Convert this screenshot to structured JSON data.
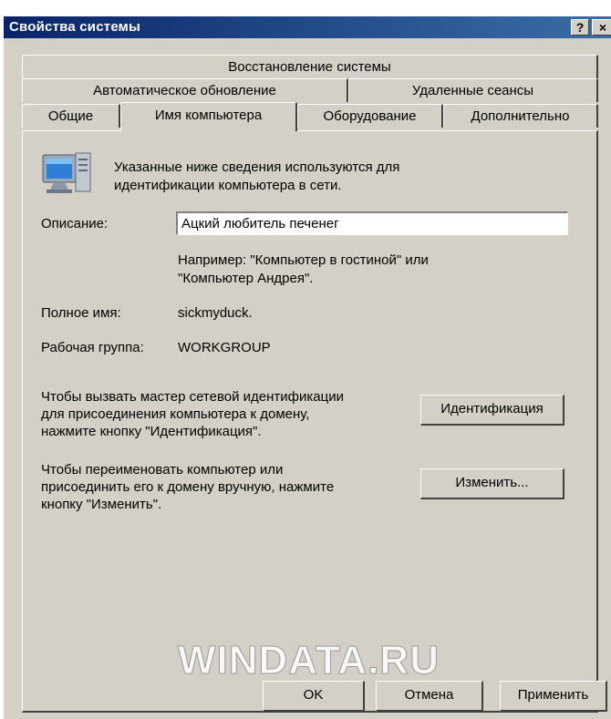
{
  "window": {
    "title": "Свойства системы",
    "help_glyph": "?",
    "close_glyph": "×"
  },
  "tabs": {
    "row1": [
      "Восстановление системы"
    ],
    "row2": [
      "Автоматическое обновление",
      "Удаленные сеансы"
    ],
    "row3": [
      "Общие",
      "Имя компьютера",
      "Оборудование",
      "Дополнительно"
    ],
    "active": "Имя компьютера"
  },
  "panel": {
    "intro_line1": "Указанные ниже сведения используются для",
    "intro_line2": "идентификации компьютера в сети.",
    "description_label": "Описание:",
    "description_value": "Ацкий любитель печенег",
    "example_line1": "Например: \"Компьютер в гостиной\" или",
    "example_line2": "\"Компьютер Андрея\".",
    "fullname_label": "Полное имя:",
    "fullname_value": "sickmyduck.",
    "workgroup_label": "Рабочая группа:",
    "workgroup_value": "WORKGROUP",
    "wizard_line1": "Чтобы вызвать мастер сетевой идентификации",
    "wizard_line2": "для присоединения компьютера к домену,",
    "wizard_line3": "нажмите кнопку \"Идентификация\".",
    "identify_button": "Идентификация",
    "rename_line1": "Чтобы переименовать компьютер или",
    "rename_line2": "присоединить его к домену вручную, нажмите",
    "rename_line3": "кнопку \"Изменить\".",
    "change_button": "Изменить..."
  },
  "footer": {
    "ok_button": "OK",
    "cancel_button": "Отмена",
    "apply_button": "Применить"
  },
  "watermark": "WINDATA.RU"
}
